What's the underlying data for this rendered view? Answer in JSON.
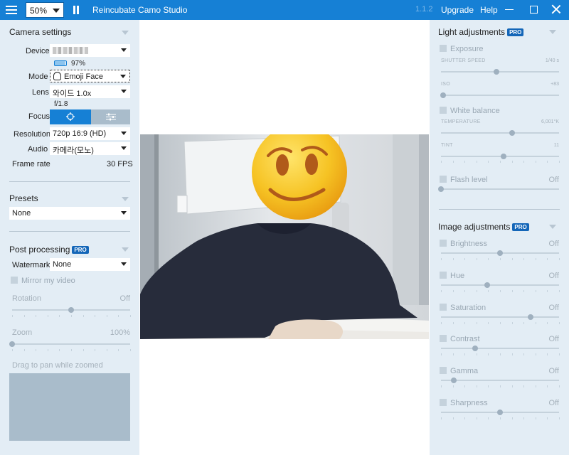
{
  "titlebar": {
    "menu_icon": "hamburger-icon",
    "zoom_value": "50%",
    "pause_icon": "pause-icon",
    "app_title": "Reincubate Camo Studio",
    "version": "1.1.2",
    "upgrade_label": "Upgrade",
    "help_label": "Help"
  },
  "camera_settings": {
    "title": "Camera settings",
    "device_label": "Device",
    "battery_text": "97%",
    "mode_label": "Mode",
    "mode_value": "Emoji Face",
    "lens_label": "Lens",
    "lens_value": "와이드 1.0x",
    "aperture": "f/1.8",
    "focus_label": "Focus",
    "resolution_label": "Resolution",
    "resolution_value": "720p 16:9 (HD)",
    "audio_label": "Audio",
    "audio_value": "카메라(모노)",
    "frame_rate_label": "Frame rate",
    "frame_rate_value": "30 FPS"
  },
  "presets": {
    "title": "Presets",
    "value": "None"
  },
  "post_processing": {
    "title": "Post processing",
    "pro": "PRO",
    "watermark_label": "Watermark",
    "watermark_value": "None",
    "mirror_label": "Mirror my video",
    "rotation_label": "Rotation",
    "rotation_value": "Off",
    "rotation_level": 0.5,
    "zoom_label": "Zoom",
    "zoom_value": "100%",
    "zoom_level": 0.0,
    "pan_hint": "Drag to pan while zoomed"
  },
  "light_adjustments": {
    "title": "Light adjustments",
    "pro": "PRO",
    "exposure_label": "Exposure",
    "shutter_label": "SHUTTER SPEED",
    "shutter_value": "1/40 s",
    "shutter_level": 0.47,
    "iso_label": "ISO",
    "iso_value": "+83",
    "iso_level": 0.02,
    "white_balance_label": "White balance",
    "temperature_label": "TEMPERATURE",
    "temperature_value": "6,001°K",
    "temperature_level": 0.6,
    "tint_label": "TINT",
    "tint_value": "11",
    "tint_level": 0.53,
    "flash_label": "Flash level",
    "flash_value": "Off",
    "flash_level": 0.0
  },
  "image_adjustments": {
    "title": "Image adjustments",
    "pro": "PRO",
    "items": [
      {
        "label": "Brightness",
        "value": "Off",
        "level": 0.5
      },
      {
        "label": "Hue",
        "value": "Off",
        "level": 0.39
      },
      {
        "label": "Saturation",
        "value": "Off",
        "level": 0.76
      },
      {
        "label": "Contrast",
        "value": "Off",
        "level": 0.29
      },
      {
        "label": "Gamma",
        "value": "Off",
        "level": 0.11
      },
      {
        "label": "Sharpness",
        "value": "Off",
        "level": 0.5
      }
    ]
  },
  "colors": {
    "accent": "#1680d5",
    "panel_bg": "#e3edf5",
    "pro_badge": "#1466b8",
    "emoji_yellow": "#f6c324"
  }
}
